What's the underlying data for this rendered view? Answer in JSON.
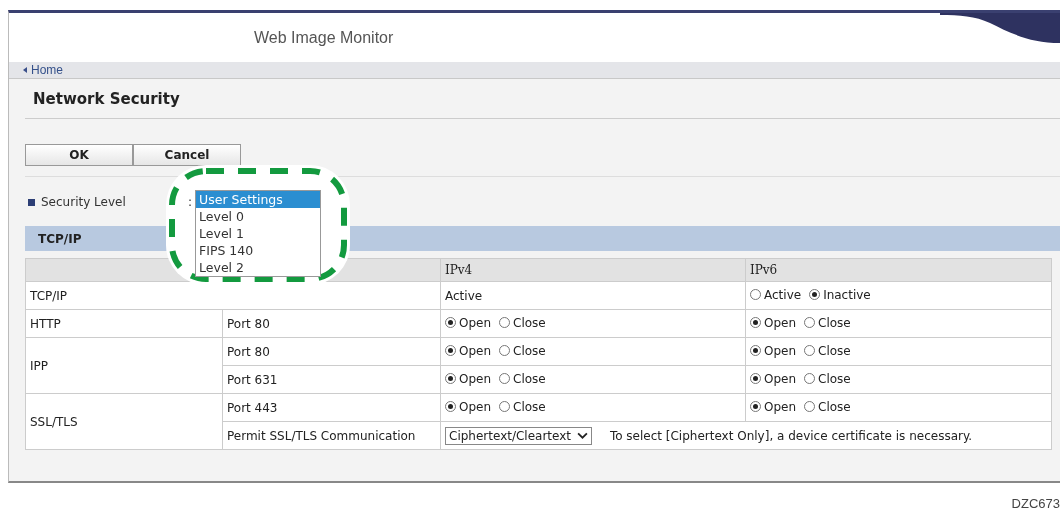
{
  "header": {
    "title": "Web Image Monitor"
  },
  "nav": {
    "home_link": "Home"
  },
  "page": {
    "title": "Network Security"
  },
  "buttons": [
    "OK",
    "Cancel"
  ],
  "security_level": {
    "label": "Security Level",
    "separator": ":",
    "options": [
      {
        "label": "User Settings",
        "selected": true
      },
      {
        "label": "Level 0",
        "selected": false
      },
      {
        "label": "Level 1",
        "selected": false
      },
      {
        "label": "FIPS 140",
        "selected": false
      },
      {
        "label": "Level 2",
        "selected": false
      }
    ]
  },
  "section": {
    "title": "TCP/IP"
  },
  "table": {
    "columns": [
      "IPv4",
      "IPv6"
    ],
    "groups": [
      {
        "label": "TCP/IP",
        "rows": [
          {
            "cells": [
              {
                "kind": "text",
                "text": "Active"
              },
              {
                "kind": "radio",
                "options": [
                  {
                    "label": "Active",
                    "selected": false
                  },
                  {
                    "label": "Inactive",
                    "selected": true
                  }
                ]
              }
            ]
          }
        ]
      },
      {
        "label": "HTTP",
        "rows": [
          {
            "port": "Port 80",
            "cells": [
              {
                "kind": "radio",
                "options": [
                  {
                    "label": "Open",
                    "selected": true
                  },
                  {
                    "label": "Close",
                    "selected": false
                  }
                ]
              },
              {
                "kind": "radio",
                "options": [
                  {
                    "label": "Open",
                    "selected": true
                  },
                  {
                    "label": "Close",
                    "selected": false
                  }
                ]
              }
            ]
          }
        ]
      },
      {
        "label": "IPP",
        "rows": [
          {
            "port": "Port 80",
            "cells": [
              {
                "kind": "radio",
                "options": [
                  {
                    "label": "Open",
                    "selected": true
                  },
                  {
                    "label": "Close",
                    "selected": false
                  }
                ]
              },
              {
                "kind": "radio",
                "options": [
                  {
                    "label": "Open",
                    "selected": true
                  },
                  {
                    "label": "Close",
                    "selected": false
                  }
                ]
              }
            ]
          },
          {
            "port": "Port 631",
            "cells": [
              {
                "kind": "radio",
                "options": [
                  {
                    "label": "Open",
                    "selected": true
                  },
                  {
                    "label": "Close",
                    "selected": false
                  }
                ]
              },
              {
                "kind": "radio",
                "options": [
                  {
                    "label": "Open",
                    "selected": true
                  },
                  {
                    "label": "Close",
                    "selected": false
                  }
                ]
              }
            ]
          }
        ]
      },
      {
        "label": "SSL/TLS",
        "rows": [
          {
            "port": "Port 443",
            "cells": [
              {
                "kind": "radio",
                "options": [
                  {
                    "label": "Open",
                    "selected": true
                  },
                  {
                    "label": "Close",
                    "selected": false
                  }
                ]
              },
              {
                "kind": "radio",
                "options": [
                  {
                    "label": "Open",
                    "selected": true
                  },
                  {
                    "label": "Close",
                    "selected": false
                  }
                ]
              }
            ]
          },
          {
            "port": "Permit SSL/TLS Communication",
            "cells": [
              {
                "kind": "select",
                "colspan": 2,
                "value": "Ciphertext/Cleartext",
                "note": "To select [Ciphertext Only], a device certificate is necessary."
              }
            ]
          }
        ]
      }
    ]
  },
  "figure_code": "DZC673"
}
